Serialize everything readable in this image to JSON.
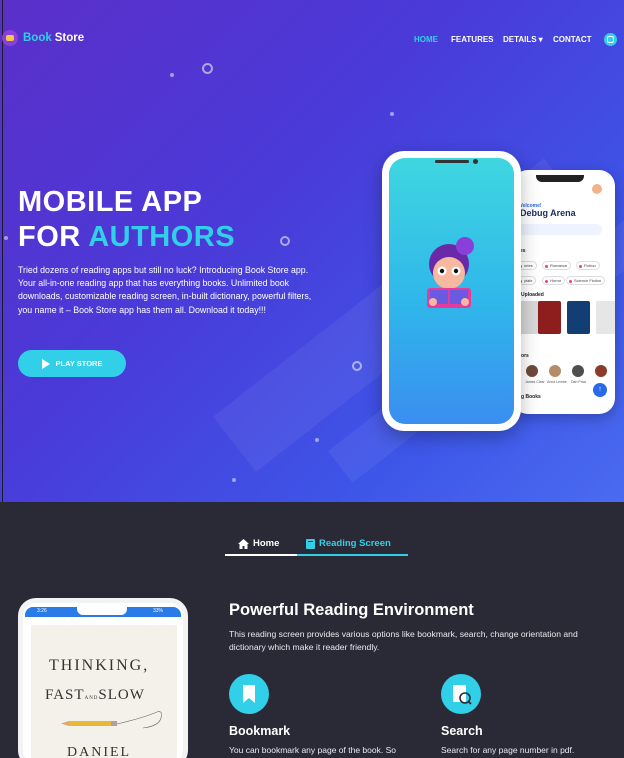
{
  "brand": {
    "name_part1": "Book",
    "name_part2": "Store"
  },
  "nav": {
    "items": [
      "HOME",
      "FEATURES",
      "DETAILS",
      "CONTACT"
    ],
    "details_caret": "▾"
  },
  "hero": {
    "title_line1": "MOBILE APP",
    "title_line2_prefix": "FOR",
    "title_line2_accent": "AUTHORS",
    "description": "Tried dozens of reading apps but still no luck? Introducing Book Store app. Your all-in-one reading app that has everything books. Unlimited book downloads, customizable reading screen, in-built dictionary, powerful filters, you name it – Book Store app has them all. Download it today!!!",
    "cta_label": "PLAY STORE"
  },
  "phone_app": {
    "greeting": "Welcome!",
    "user_name": "Debug Arena",
    "section_genres": "res",
    "genres": [
      "ories",
      "Romance",
      "Fiction",
      "ytale",
      "Horror",
      "Science Fiction"
    ],
    "section_uploaded": "t Uploaded",
    "section_authors": "hors",
    "authors": [
      "James Clear",
      "Anna Lemke",
      "Dan Price",
      "Tara Westover"
    ],
    "section_trending": "ng Books",
    "fab_label": "↑"
  },
  "tabs": [
    {
      "label": "Home",
      "icon": "home-icon"
    },
    {
      "label": "Reading Screen",
      "icon": "book-icon"
    }
  ],
  "reading_phone": {
    "status_left": "3:26",
    "status_right": "33%",
    "book_title_1": "THINKING,",
    "book_title_2a": "FAST",
    "book_title_2b": "AND",
    "book_title_2c": "SLOW",
    "book_author": "DANIEL"
  },
  "reading_section": {
    "title": "Powerful Reading Environment",
    "description": "This reading screen provides various options like bookmark, search, change orientation and dictionary which make it reader friendly.",
    "features": [
      {
        "icon": "bookmark-icon",
        "title": "Bookmark",
        "description": "You can bookmark any page of the book. So"
      },
      {
        "icon": "search-icon",
        "title": "Search",
        "description": "Search for any page number in pdf."
      }
    ]
  },
  "colors": {
    "accent": "#31d0e8",
    "hero_start": "#5b2fc9",
    "hero_end": "#4a6bf0",
    "dark_bg": "#2a2a36"
  }
}
